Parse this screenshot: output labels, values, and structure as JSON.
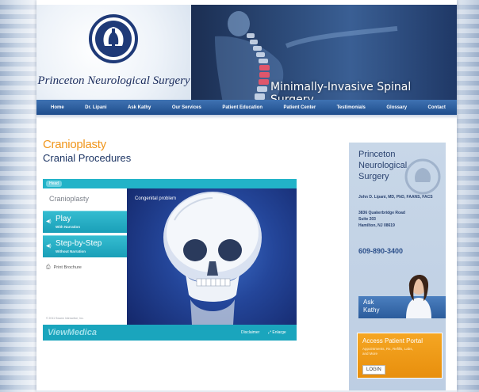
{
  "header": {
    "logo_name": "Princeton Neurological Surgery",
    "tagline": "Minimally-Invasive Spinal Surgery"
  },
  "nav": {
    "items": [
      {
        "label": "Home"
      },
      {
        "label": "Dr. Lipani"
      },
      {
        "label": "Ask Kathy"
      },
      {
        "label": "Our Services"
      },
      {
        "label": "Patient Education"
      },
      {
        "label": "Patient Center"
      },
      {
        "label": "Testimonials"
      },
      {
        "label": "Glossary"
      },
      {
        "label": "Contact"
      }
    ]
  },
  "main": {
    "title": "Cranioplasty",
    "subtitle": "Cranial Procedures"
  },
  "player": {
    "head_tab": "Head",
    "side_title": "Cranioplasty",
    "play": {
      "label": "Play",
      "sub": "With Narration"
    },
    "step": {
      "label": "Step-by-Step",
      "sub": "Without Narration"
    },
    "print": "Print Brochure",
    "view_label": "Congenital problem",
    "copyright": "© 2011 Swarm Interactive, Inc.",
    "brand": "ViewMedica",
    "disclaimer": "Disclaimer",
    "enlarge": "Enlarge"
  },
  "sidebar": {
    "logo_lines": [
      "Princeton",
      "Neurological",
      "Surgery"
    ],
    "doctor": "John D. Lipani, MD, PhD, FAANS, FACS",
    "address": [
      "3836 Quakerbridge Road",
      "Suite 203",
      "Hamilton, NJ 08619"
    ],
    "phone": "609-890-3400",
    "ask_lines": [
      "Ask",
      "Kathy"
    ],
    "portal_title": "Access Patient Portal",
    "portal_sub": "Appointments, Rx, Refills, Labs, and More",
    "login": "LOGIN"
  },
  "colors": {
    "nav_blue": "#2b5c9c",
    "title_orange": "#f0961c",
    "player_teal": "#1aa5bd",
    "portal_orange": "#f5a623"
  }
}
